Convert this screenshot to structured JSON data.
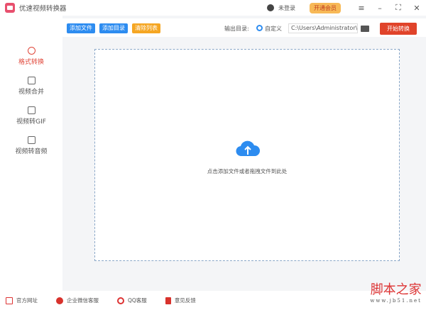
{
  "app": {
    "title": "优速视频转换器",
    "user": "未登录",
    "vip": "开通会员"
  },
  "toolbar": {
    "add_file": "添加文件",
    "add_dir": "添加目录",
    "clear": "清除列表",
    "output_label": "输出目录:",
    "custom": "自定义",
    "path": "C:\\Users\\Administrator\\",
    "start": "开始转换"
  },
  "sidebar": {
    "items": [
      {
        "label": "格式转换"
      },
      {
        "label": "视频合并"
      },
      {
        "label": "视频转GIF"
      },
      {
        "label": "视频转音频"
      }
    ]
  },
  "drop": {
    "hint": "点击添加文件或者拖拽文件到此处"
  },
  "footer": {
    "items": [
      {
        "label": "官方网址"
      },
      {
        "label": "企业微信客服"
      },
      {
        "label": "QQ客服"
      },
      {
        "label": "意见反馈"
      }
    ]
  },
  "watermark": {
    "title": "脚本之家",
    "url": "www.jb51.net"
  },
  "colors": {
    "accent": "#e0432a",
    "blue": "#2d8cf0",
    "orange": "#f5a623"
  }
}
